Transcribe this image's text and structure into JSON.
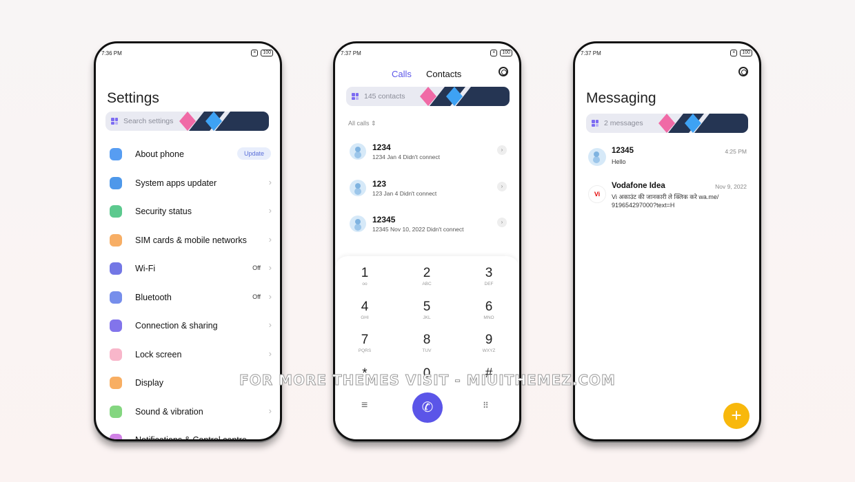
{
  "colors": {
    "accent": "#5b55e8",
    "fab": "#f8b80c",
    "banner_pink": "#f06aa6",
    "banner_navy": "#253553",
    "banner_blue": "#3ea2f4"
  },
  "settings": {
    "time": "7:36 PM",
    "battery": "100",
    "title": "Settings",
    "search_placeholder": "Search settings",
    "items": [
      {
        "label": "About phone",
        "badge": "Update",
        "icon": "phone-info-icon",
        "color": "#3a8cf0"
      },
      {
        "label": "System apps updater",
        "icon": "update-icon",
        "color": "#2f86e6"
      },
      {
        "label": "Security status",
        "icon": "shield-icon",
        "color": "#3fbf7a"
      },
      {
        "label": "SIM cards & mobile networks",
        "icon": "sim-icon",
        "color": "#f6a04a"
      },
      {
        "label": "Wi-Fi",
        "value": "Off",
        "icon": "wifi-icon",
        "color": "#5b5fe0"
      },
      {
        "label": "Bluetooth",
        "value": "Off",
        "icon": "bluetooth-icon",
        "color": "#5e7ae8"
      },
      {
        "label": "Connection & sharing",
        "icon": "connection-icon",
        "color": "#6c5ce7"
      },
      {
        "label": "Lock screen",
        "icon": "lock-icon",
        "color": "#f7a9c1"
      },
      {
        "label": "Display",
        "icon": "display-icon",
        "color": "#f7a046"
      },
      {
        "label": "Sound & vibration",
        "icon": "sound-icon",
        "color": "#6fcf6a"
      },
      {
        "label": "Notifications & Control centre",
        "icon": "notifications-icon",
        "color": "#c86be0"
      }
    ]
  },
  "phone": {
    "time": "7:37 PM",
    "battery": "100",
    "tab_calls": "Calls",
    "tab_contacts": "Contacts",
    "search_placeholder": "145 contacts",
    "filter": "All calls",
    "calls": [
      {
        "name": "1234",
        "detail": "1234  Jan 4 Didn't connect"
      },
      {
        "name": "123",
        "detail": "123  Jan 4 Didn't connect"
      },
      {
        "name": "12345",
        "detail": "12345  Nov 10, 2022 Didn't connect"
      }
    ],
    "keys": [
      {
        "d": "1",
        "l": "ᴏᴏ"
      },
      {
        "d": "2",
        "l": "ABC"
      },
      {
        "d": "3",
        "l": "DEF"
      },
      {
        "d": "4",
        "l": "GHI"
      },
      {
        "d": "5",
        "l": "JKL"
      },
      {
        "d": "6",
        "l": "MNO"
      },
      {
        "d": "7",
        "l": "PQRS"
      },
      {
        "d": "8",
        "l": "TUV"
      },
      {
        "d": "9",
        "l": "WXYZ"
      },
      {
        "d": "*",
        "l": ""
      },
      {
        "d": "0",
        "l": "+"
      },
      {
        "d": "#",
        "l": ""
      }
    ]
  },
  "messaging": {
    "time": "7:37 PM",
    "battery": "100",
    "title": "Messaging",
    "search_placeholder": "2 messages",
    "messages": [
      {
        "name": "12345",
        "time": "4:25 PM",
        "text": "Hello",
        "avatar": "contact"
      },
      {
        "name": "Vodafone Idea",
        "time": "Nov 9, 2022",
        "text": "Vi अकाउंट की जानकारी ले क्लिक करे wa.me/ 919654297000?text=H",
        "avatar": "Vi"
      }
    ]
  },
  "watermark": "FOR MORE THEMES VISIT - MIUITHEMEZ.COM"
}
